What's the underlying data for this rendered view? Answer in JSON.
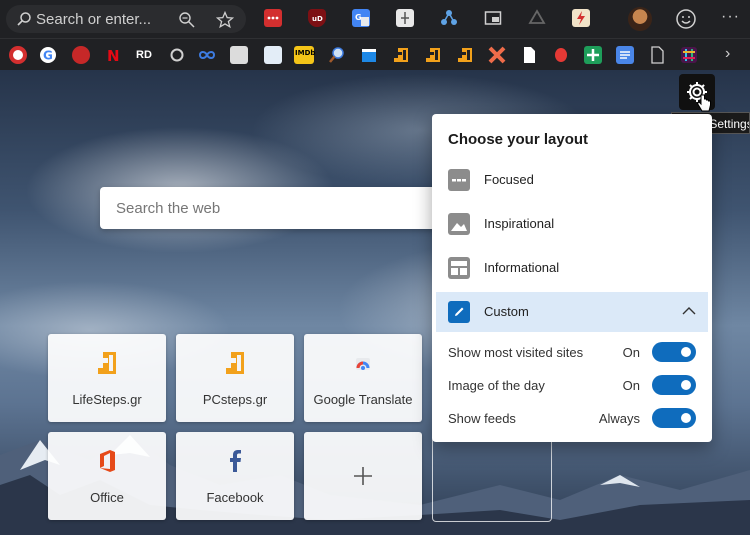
{
  "address_bar": {
    "placeholder": "Search or enter...",
    "icons": [
      "search-icon",
      "zoom-icon",
      "favorite-star-icon"
    ]
  },
  "extensions": [
    "lastpass-icon",
    "ublock-icon",
    "translate-icon",
    "extension-icon",
    "share-icon",
    "picture-in-picture-icon",
    "recycle-icon",
    "pdf-icon",
    "profile-avatar",
    "feedback-smiley-icon",
    "more-icon"
  ],
  "favorites": {
    "items": [
      "help-icon",
      "google-icon",
      "red-globe-icon",
      "netflix-icon",
      "rd-icon",
      "circle-icon",
      "infinity-icon",
      "racing-icon",
      "book-icon",
      "imdb-icon",
      "search-magnifier-icon",
      "clapper-icon",
      "lifesteps-icon",
      "pcsteps-icon",
      "lifesteps-icon-2",
      "x-icon",
      "doc-icon",
      "red-orb-icon",
      "docs-icon",
      "plus-sheet-icon",
      "docs-blue-icon",
      "blank-doc-icon",
      "slack-icon",
      "chevron-right-icon"
    ],
    "rd_label": "RD",
    "imdb_label": "IMDb"
  },
  "page_settings": {
    "tooltip": "Page Settings"
  },
  "search": {
    "placeholder": "Search the web"
  },
  "tiles": [
    {
      "label": "LifeSteps.gr",
      "icon": "lifesteps-icon"
    },
    {
      "label": "PCsteps.gr",
      "icon": "pcsteps-icon"
    },
    {
      "label": "Google Translate",
      "icon": "google-translate-icon"
    },
    {
      "label": "Office",
      "icon": "office-icon"
    },
    {
      "label": "Facebook",
      "icon": "facebook-icon"
    },
    {
      "label": "",
      "icon": "add-icon"
    }
  ],
  "layout_panel": {
    "title": "Choose your layout",
    "options": [
      {
        "label": "Focused",
        "selected": false
      },
      {
        "label": "Inspirational",
        "selected": false
      },
      {
        "label": "Informational",
        "selected": false
      },
      {
        "label": "Custom",
        "selected": true
      }
    ],
    "settings": [
      {
        "label": "Show most visited sites",
        "value": "On",
        "enabled": true
      },
      {
        "label": "Image of the day",
        "value": "On",
        "enabled": true
      },
      {
        "label": "Show feeds",
        "value": "Always",
        "enabled": true
      }
    ]
  },
  "colors": {
    "accent": "#0f6cbd",
    "selected_row": "#dbe9f8",
    "chrome": "#202124"
  }
}
